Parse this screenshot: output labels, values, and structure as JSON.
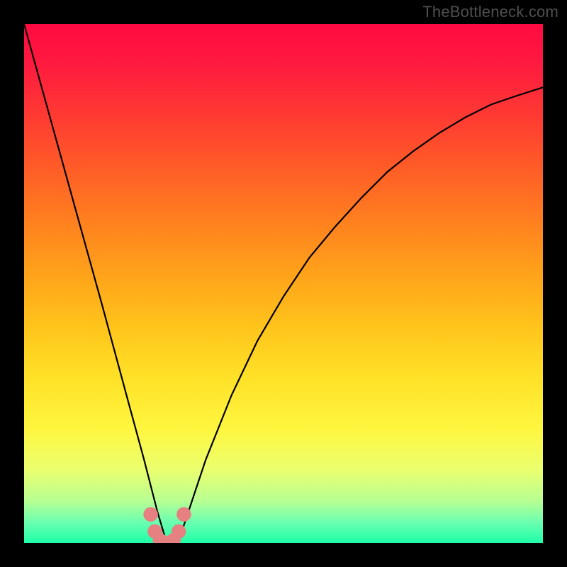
{
  "watermark": "TheBottleneck.com",
  "chart_data": {
    "type": "line",
    "title": "",
    "xlabel": "",
    "ylabel": "",
    "xlim": [
      0,
      1
    ],
    "ylim": [
      0,
      1
    ],
    "x": [
      0.0,
      0.05,
      0.1,
      0.15,
      0.2,
      0.23,
      0.257,
      0.275,
      0.3,
      0.325,
      0.35,
      0.4,
      0.45,
      0.5,
      0.55,
      0.6,
      0.65,
      0.7,
      0.75,
      0.8,
      0.85,
      0.9,
      0.95,
      1.0
    ],
    "y": [
      1.0,
      0.82,
      0.64,
      0.46,
      0.275,
      0.165,
      0.06,
      0.0,
      0.01,
      0.085,
      0.16,
      0.285,
      0.39,
      0.475,
      0.55,
      0.61,
      0.665,
      0.715,
      0.755,
      0.79,
      0.82,
      0.845,
      0.862,
      0.878
    ],
    "trough": {
      "x_range": [
        0.244,
        0.308
      ],
      "points": [
        {
          "x": 0.244,
          "y": 0.055
        },
        {
          "x": 0.252,
          "y": 0.022
        },
        {
          "x": 0.262,
          "y": 0.005
        },
        {
          "x": 0.275,
          "y": 0.0
        },
        {
          "x": 0.288,
          "y": 0.005
        },
        {
          "x": 0.298,
          "y": 0.022
        },
        {
          "x": 0.308,
          "y": 0.055
        }
      ],
      "marker_color": "#e78080",
      "marker_radius_frac": 0.014
    },
    "curve_stroke": "#000000",
    "curve_stroke_width": 2.2,
    "gradient_stops": [
      {
        "pos": 0.0,
        "color": "#ff0a42"
      },
      {
        "pos": 0.08,
        "color": "#ff1b3f"
      },
      {
        "pos": 0.18,
        "color": "#ff3b32"
      },
      {
        "pos": 0.28,
        "color": "#ff5d27"
      },
      {
        "pos": 0.38,
        "color": "#ff801f"
      },
      {
        "pos": 0.48,
        "color": "#ffa21a"
      },
      {
        "pos": 0.58,
        "color": "#ffc31b"
      },
      {
        "pos": 0.68,
        "color": "#ffe127"
      },
      {
        "pos": 0.78,
        "color": "#fff63f"
      },
      {
        "pos": 0.86,
        "color": "#eaff6f"
      },
      {
        "pos": 0.92,
        "color": "#b6ff93"
      },
      {
        "pos": 0.96,
        "color": "#6bffb0"
      },
      {
        "pos": 1.0,
        "color": "#1fffa8"
      }
    ]
  },
  "layout": {
    "image_size": 800,
    "inner_margin": 34
  }
}
